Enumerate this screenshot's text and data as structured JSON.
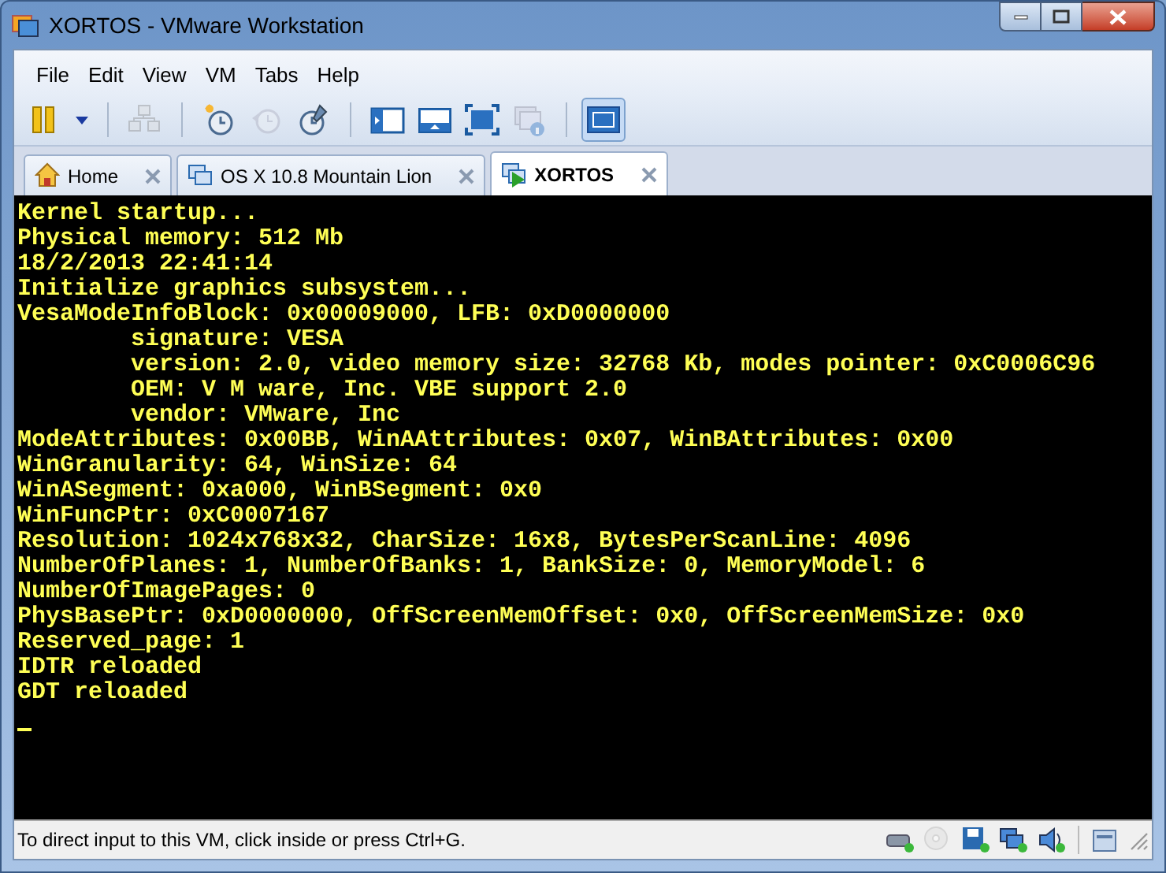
{
  "window": {
    "title": "XORTOS - VMware Workstation"
  },
  "menu": [
    "File",
    "Edit",
    "View",
    "VM",
    "Tabs",
    "Help"
  ],
  "toolbar": [
    [
      {
        "kind": "pause",
        "disabled": false,
        "selected": false
      },
      {
        "kind": "dropdown",
        "disabled": false,
        "selected": false
      }
    ],
    [
      {
        "kind": "network",
        "disabled": true,
        "selected": false
      }
    ],
    [
      {
        "kind": "snapshot-take",
        "disabled": false,
        "selected": false
      },
      {
        "kind": "snapshot-revert",
        "disabled": true,
        "selected": false
      },
      {
        "kind": "snapshot-manage",
        "disabled": false,
        "selected": false
      }
    ],
    [
      {
        "kind": "view-sidebar",
        "disabled": false,
        "selected": false
      },
      {
        "kind": "view-thumbs",
        "disabled": false,
        "selected": false
      },
      {
        "kind": "fullscreen",
        "disabled": false,
        "selected": false
      },
      {
        "kind": "unity",
        "disabled": true,
        "selected": false
      }
    ],
    [
      {
        "kind": "console-view",
        "disabled": false,
        "selected": true
      }
    ]
  ],
  "tabs": [
    {
      "label": "Home",
      "kind": "home",
      "selected": false
    },
    {
      "label": "OS X 10.8 Mountain Lion",
      "kind": "vm",
      "selected": false
    },
    {
      "label": "XORTOS",
      "kind": "vm-running",
      "selected": true
    }
  ],
  "console": {
    "lines": [
      "Kernel startup...",
      "Physical memory: 512 Mb",
      "18/2/2013 22:41:14",
      "Initialize graphics subsystem...",
      "VesaModeInfoBlock: 0x00009000, LFB: 0xD0000000",
      "        signature: VESA",
      "        version: 2.0, video memory size: 32768 Kb, modes pointer: 0xC0006C96",
      "        OEM: V M ware, Inc. VBE support 2.0",
      "        vendor: VMware, Inc",
      "ModeAttributes: 0x00BB, WinAAttributes: 0x07, WinBAttributes: 0x00",
      "WinGranularity: 64, WinSize: 64",
      "WinASegment: 0xa000, WinBSegment: 0x0",
      "WinFuncPtr: 0xC0007167",
      "Resolution: 1024x768x32, CharSize: 16x8, BytesPerScanLine: 4096",
      "NumberOfPlanes: 1, NumberOfBanks: 1, BankSize: 0, MemoryModel: 6",
      "NumberOfImagePages: 0",
      "PhysBasePtr: 0xD0000000, OffScreenMemOffset: 0x0, OffScreenMemSize: 0x0",
      "Reserved_page: 1",
      "IDTR reloaded",
      "GDT reloaded"
    ],
    "cursor": true
  },
  "status_bar": {
    "text": "To direct input to this VM, click inside or press Ctrl+G.",
    "devices": [
      {
        "kind": "hdd",
        "disabled": false
      },
      {
        "kind": "cdrom",
        "disabled": true
      },
      {
        "kind": "floppy",
        "disabled": false
      },
      {
        "kind": "network",
        "disabled": false
      },
      {
        "kind": "sound",
        "disabled": false
      }
    ]
  }
}
